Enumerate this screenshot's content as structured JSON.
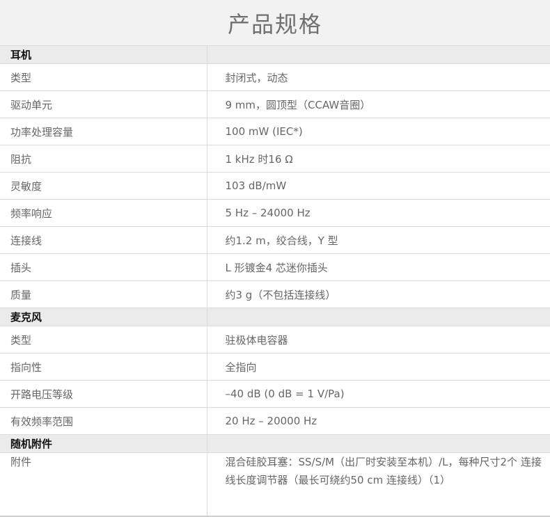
{
  "page": {
    "title": "产品规格"
  },
  "sections": [
    {
      "name": "耳机",
      "rows": [
        {
          "label": "类型",
          "value": "封闭式，动态"
        },
        {
          "label": "驱动单元",
          "value": "9 mm，圆顶型（CCAW音圈）"
        },
        {
          "label": "功率处理容量",
          "value": "100 mW (IEC*)"
        },
        {
          "label": "阻抗",
          "value": "1 kHz 时16 Ω"
        },
        {
          "label": "灵敏度",
          "value": "103 dB/mW"
        },
        {
          "label": "频率响应",
          "value": "5 Hz – 24000 Hz"
        },
        {
          "label": "连接线",
          "value": "约1.2 m，绞合线，Y 型"
        },
        {
          "label": "插头",
          "value": "L 形镀金4 芯迷你插头"
        },
        {
          "label": "质量",
          "value": "约3 g（不包括连接线）"
        }
      ]
    },
    {
      "name": "麦克风",
      "rows": [
        {
          "label": "类型",
          "value": "驻极体电容器"
        },
        {
          "label": "指向性",
          "value": "全指向"
        },
        {
          "label": "开路电压等级",
          "value": "–40 dB (0 dB = 1 V/Pa)"
        },
        {
          "label": "有效频率范围",
          "value": "20 Hz – 20000 Hz"
        }
      ]
    },
    {
      "name": "随机附件",
      "rows": [
        {
          "label": "附件",
          "value": "混合硅胶耳塞：SS/S/M（出厂时安装至本机）/L，每种尺寸2个 连接线长度调节器（最长可绕约50 cm 连接线）（1）"
        }
      ]
    }
  ],
  "colors": {
    "title_bg": "#f2f2f2",
    "section_bg": "#ebebeb",
    "border": "#dcdcdc",
    "text": "#666666",
    "section_text": "#111111"
  }
}
